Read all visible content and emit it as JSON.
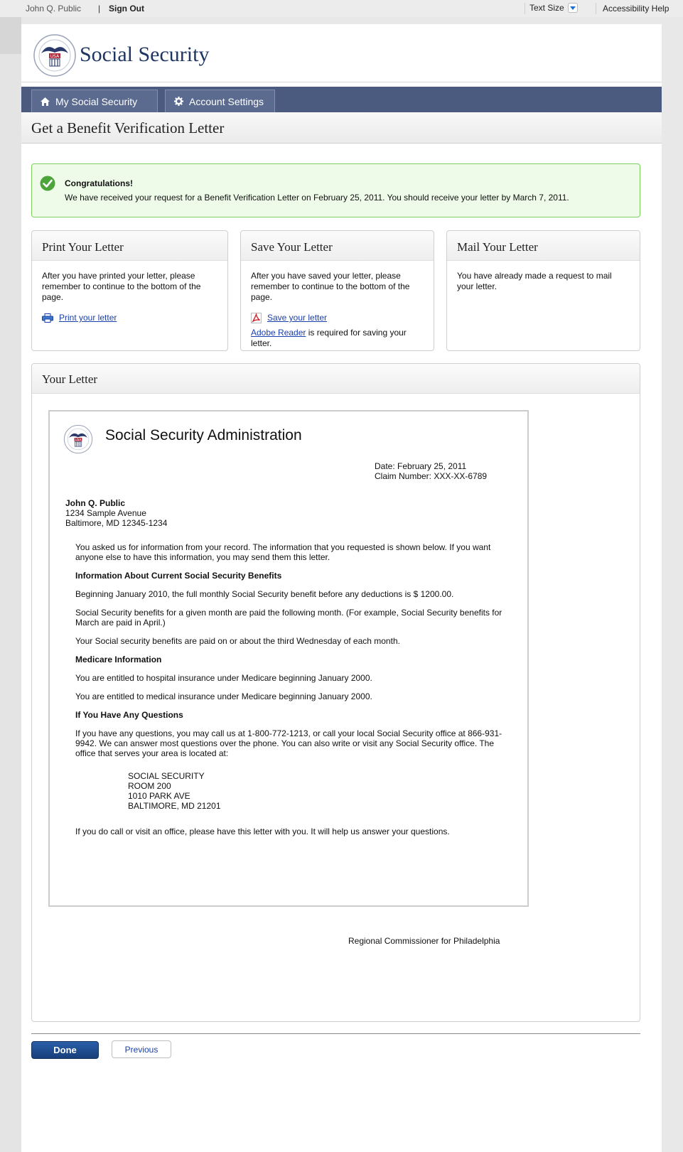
{
  "utility": {
    "user_name": "John Q. Public",
    "separator": "|",
    "sign_out": "Sign Out",
    "text_size": "Text Size",
    "accessibility": "Accessibility Help"
  },
  "header": {
    "brand": "Social Security",
    "seal_text": "USA"
  },
  "nav": {
    "tabs": [
      {
        "label": "My Social Security",
        "icon": "home-icon"
      },
      {
        "label": "Account Settings",
        "icon": "gear-icon"
      }
    ]
  },
  "page_title": "Get a Benefit Verification Letter",
  "success": {
    "title": "Congratulations!",
    "message": "We have received your request for a Benefit Verification Letter on February 25, 2011. You should receive your letter by March 7, 2011."
  },
  "cards": {
    "print": {
      "title": "Print Your Letter",
      "text": "After you have printed your letter, please remember to continue to the bottom of the page.",
      "link": "Print your letter"
    },
    "save": {
      "title": "Save Your Letter",
      "text": "After you have saved your letter, please remember to continue to the bottom of the page.",
      "link": "Save your letter",
      "reader_link": "Adobe Reader",
      "reader_note": " is required for saving your letter."
    },
    "mail": {
      "title": "Mail Your Letter",
      "text": "You have already made a request to mail your letter."
    }
  },
  "letter": {
    "panel_title": "Your Letter",
    "org": "Social Security Administration",
    "date_line": "Date:  February 25, 2011",
    "claim_line": "Claim Number:  XXX-XX-6789",
    "recipient": {
      "name": "John Q. Public",
      "street": "1234 Sample Avenue",
      "city": "Baltimore, MD 12345-1234"
    },
    "intro": "You asked us for information from your record.  The information that you requested is shown below.  If you want anyone else to have this information, you may send them this letter.",
    "h_benefits": "Information About Current Social Security Benefits",
    "p_benefit_amount": "Beginning January 2010, the full monthly Social Security benefit before any deductions is $ 1200.00.",
    "p_paid_month": "Social Security benefits for a given month are paid the following month.  (For example, Social Security benefits for March are paid in April.)",
    "p_paid_day": "Your Social security benefits are paid on or about the third Wednesday of each month.",
    "h_medicare": "Medicare Information",
    "p_hospital": "You are entitled to hospital insurance under Medicare beginning January 2000.",
    "p_medical": "You are entitled to medical insurance under Medicare beginning January 2000.",
    "h_questions": "If You Have Any Questions",
    "p_questions": "If you have any questions, you may call us at 1-800-772-1213, or call your local Social Security office at 866-931-9942.  We can answer most questions over the phone.  You can also write or visit any Social Security office.  The office that serves your area is located at:",
    "office": {
      "line1": "SOCIAL SECURITY",
      "line2": "ROOM 200",
      "line3": "1010 PARK AVE",
      "line4": "BALTIMORE, MD 21201"
    },
    "p_visit": "If you do call or visit an office, please have this letter with you.  It will help us answer your questions.",
    "signature": "Regional Commissioner for Philadelphia"
  },
  "buttons": {
    "done": "Done",
    "previous": "Previous"
  },
  "colors": {
    "nav": "#4a5b7f",
    "brand": "#1e3561",
    "success_bg": "#eefbe9",
    "success_border": "#7ed05a",
    "link": "#1a3faa",
    "done_button": "#1f4f92"
  }
}
